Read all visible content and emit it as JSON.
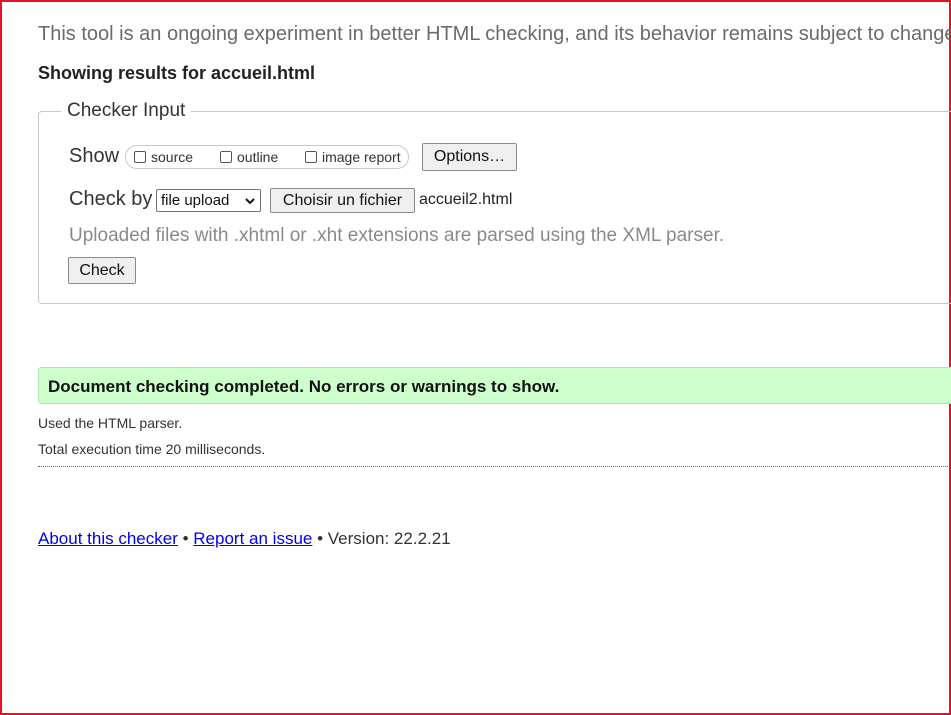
{
  "intro_text": "This tool is an ongoing experiment in better HTML checking, and its behavior remains subject to change",
  "results_title": "Showing results for accueil.html",
  "checker_input": {
    "legend": "Checker Input",
    "show_label": "Show",
    "show_options": [
      "source",
      "outline",
      "image report"
    ],
    "options_button": "Options…",
    "check_by_label": "Check by",
    "check_by_value": "file upload",
    "choose_file_button": "Choisir un fichier",
    "file_name": "accueil2.html",
    "note": "Uploaded files with .xhtml or .xht extensions are parsed using the XML parser.",
    "check_button": "Check"
  },
  "result": {
    "message": "Document checking completed. No errors or warnings to show.",
    "parser": "Used the HTML parser.",
    "execution_time": "Total execution time 20 milliseconds."
  },
  "footer": {
    "about_link": "About this checker",
    "separator": "•",
    "report_link": "Report an issue",
    "version": "Version: 22.2.21"
  },
  "colors": {
    "frame_border": "#e81123",
    "success_bg": "#ccffcc",
    "link": "#0000ee"
  }
}
